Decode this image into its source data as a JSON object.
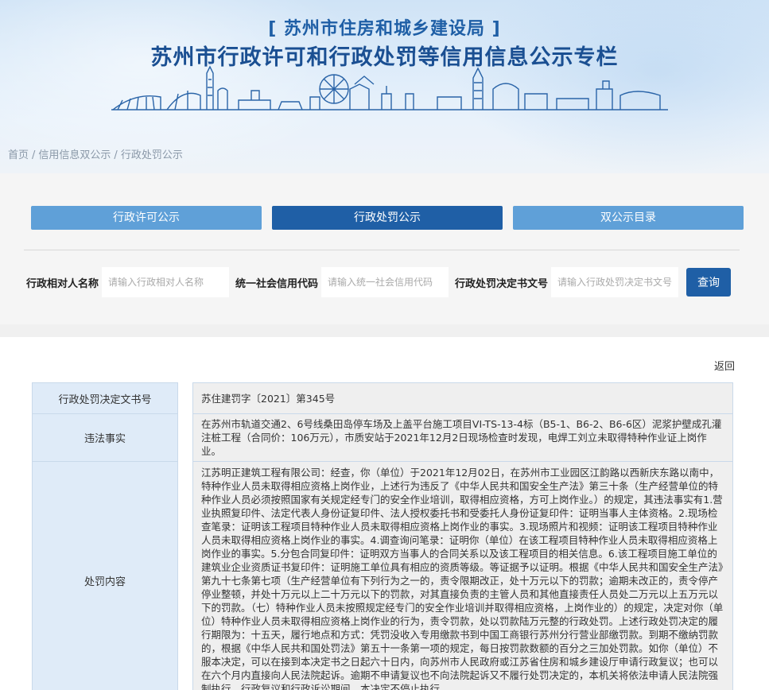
{
  "header": {
    "subtitle": "[ 苏州市住房和城乡建设局 ]",
    "title": "苏州市行政许可和行政处罚等信用信息公示专栏"
  },
  "breadcrumb": [
    "首页",
    "/",
    "信用信息双公示",
    "/",
    "行政处罚公示"
  ],
  "tabs": [
    {
      "label": "行政许可公示",
      "active": false
    },
    {
      "label": "行政处罚公示",
      "active": true
    },
    {
      "label": "双公示目录",
      "active": false
    }
  ],
  "search": {
    "field1_label": "行政相对人名称",
    "field1_placeholder": "请输入行政相对人名称",
    "field2_label": "统一社会信用代码",
    "field2_placeholder": "请输入统一社会信用代码",
    "field3_label": "行政处罚决定书文号",
    "field3_placeholder": "请输入行政处罚决定书文号",
    "button": "查询"
  },
  "detail": {
    "back": "返回",
    "rows": [
      {
        "key": "行政处罚决定文书号",
        "value": "苏住建罚字〔2021〕第345号"
      },
      {
        "key": "违法事实",
        "value": "在苏州市轨道交通2、6号线桑田岛停车场及上盖平台施工项目VI-TS-13-4标（B5-1、B6-2、B6-6区）泥浆护壁成孔灌注桩工程（合同价：106万元），市质安站于2021年12月2日现场检查时发现，电焊工刘立未取得特种作业证上岗作业。"
      },
      {
        "key": "处罚内容",
        "value": "江苏明正建筑工程有限公司：经查，你（单位）于2021年12月02日，在苏州市工业园区江韵路以西新庆东路以南中，特种作业人员未取得相应资格上岗作业，上述行为违反了《中华人民共和国安全生产法》第三十条（生产经营单位的特种作业人员必须按照国家有关规定经专门的安全作业培训，取得相应资格，方可上岗作业。）的规定，其违法事实有1.营业执照复印件、法定代表人身份证复印件、法人授权委托书和受委托人身份证复印件：证明当事人主体资格。2.现场检查笔录：证明该工程项目特种作业人员未取得相应资格上岗作业的事实。3.现场照片和视频：证明该工程项目特种作业人员未取得相应资格上岗作业的事实。4.调查询问笔录：证明你（单位）在该工程项目特种作业人员未取得相应资格上岗作业的事实。5.分包合同复印件：证明双方当事人的合同关系以及该工程项目的相关信息。6.该工程项目施工单位的建筑业企业资质证书复印件：证明施工单位具有相应的资质等级。等证据予以证明。根据《中华人民共和国安全生产法》第九十七条第七项（生产经营单位有下列行为之一的，责令限期改正，处十万元以下的罚款；逾期未改正的，责令停产停业整顿，并处十万元以上二十万元以下的罚款，对其直接负责的主管人员和其他直接责任人员处二万元以上五万元以下的罚款。（七）特种作业人员未按照规定经专门的安全作业培训并取得相应资格，上岗作业的）的规定，决定对你（单位）特种作业人员未取得相应资格上岗作业的行为，责令罚款，处以罚款陆万元整的行政处罚。上述行政处罚决定的履行期限为：十五天，履行地点和方式：凭罚没收入专用缴款书到中国工商银行苏州分行营业部缴罚款。到期不缴纳罚款的，根据《中华人民共和国处罚法》第五十一条第一项的规定，每日按罚款数额的百分之三加处罚款。如你（单位）不服本决定，可以在接到本决定书之日起六十日内，向苏州市人民政府或江苏省住房和城乡建设厅申请行政复议；也可以在六个月内直接向人民法院起诉。逾期不申请复议也不向法院起诉又不履行处罚决定的，本机关将依法申请人民法院强制执行。行政复议和行政诉讼期间，本决定不停止执行。"
      }
    ]
  }
}
